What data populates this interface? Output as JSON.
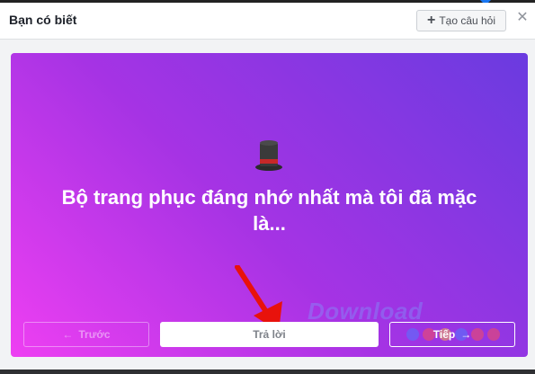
{
  "dialog": {
    "title": "Bạn có biết",
    "create_question_label": "Tạo câu hỏi",
    "close_icon": "close-icon"
  },
  "card": {
    "icon": "top-hat-icon",
    "prompt": "Bộ trang phục đáng nhớ nhất mà tôi đã mặc là...",
    "gradient": [
      "#ee3ff2",
      "#a633e4",
      "#6a3be0"
    ]
  },
  "footer": {
    "prev_label": "Trước",
    "answer_label": "Trả lời",
    "next_label": "Tiếp"
  },
  "watermark": {
    "text": "Download"
  },
  "colors": {
    "accent": "#1877f2"
  }
}
